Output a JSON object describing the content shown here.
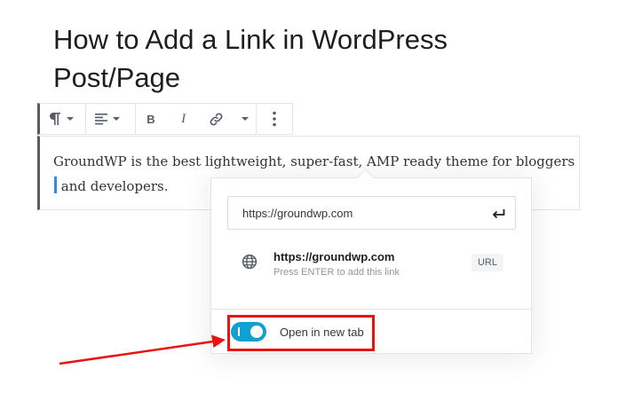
{
  "post": {
    "title": "How to Add a Link in WordPress Post/Page",
    "paragraph": "GroundWP is the best lightweight, super-fast, AMP ready theme for bloggers and developers."
  },
  "toolbar": {
    "icons": [
      "paragraph-icon",
      "chevron-down-icon",
      "align-left-icon",
      "chevron-down-icon",
      "bold-icon",
      "italic-icon",
      "link-icon",
      "chevron-down-icon",
      "more-vertical-icon"
    ],
    "bold_label": "B",
    "italic_label": "I"
  },
  "link_popover": {
    "url_value": "https://groundwp.com",
    "submit_icon": "enter-icon",
    "suggestion": {
      "icon": "globe-icon",
      "title": "https://groundwp.com",
      "hint": "Press ENTER to add this link",
      "type": "URL"
    },
    "settings": {
      "new_tab_label": "Open in new tab",
      "new_tab_enabled": true
    }
  },
  "colors": {
    "toggle_on": "#11a0d2",
    "annotation": "#e8140e",
    "caret": "#2f8ae0"
  }
}
